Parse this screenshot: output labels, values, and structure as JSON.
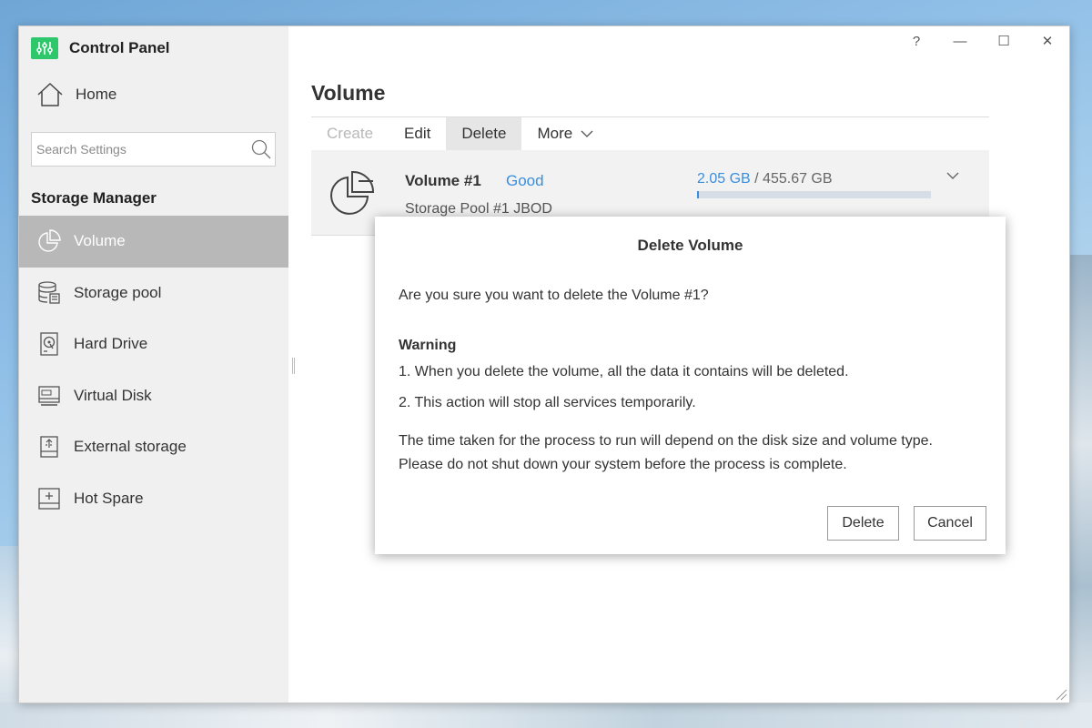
{
  "app": {
    "title": "Control Panel",
    "logo_color": "#2ec76b"
  },
  "sidebar": {
    "home_label": "Home",
    "search_placeholder": "Search Settings",
    "section_title": "Storage Manager",
    "items": [
      {
        "label": "Volume",
        "icon": "pie-chart-icon",
        "active": true
      },
      {
        "label": "Storage pool",
        "icon": "database-icon"
      },
      {
        "label": "Hard Drive",
        "icon": "hard-drive-icon"
      },
      {
        "label": "Virtual Disk",
        "icon": "virtual-disk-icon"
      },
      {
        "label": "External storage",
        "icon": "external-storage-icon"
      },
      {
        "label": "Hot Spare",
        "icon": "hot-spare-icon"
      }
    ]
  },
  "window_controls": {
    "help": "?",
    "minimize": "—",
    "maximize": "☐",
    "close": "✕"
  },
  "main": {
    "title": "Volume",
    "toolbar": {
      "create": "Create",
      "edit": "Edit",
      "delete": "Delete",
      "more": "More"
    },
    "volume": {
      "name": "Volume #1",
      "status": "Good",
      "pool": "Storage Pool #1  JBOD",
      "used": "2.05 GB",
      "separator": " / ",
      "total": "455.67 GB",
      "usage_fraction": 0.0045
    }
  },
  "dialog": {
    "title": "Delete Volume",
    "question": "Are you sure you want to delete the Volume #1?",
    "warning_title": "Warning",
    "warning_1": "1. When you delete the volume, all the data it contains will be deleted.",
    "warning_2": "2. This action will stop all services temporarily.",
    "time_note": "The time taken for the process to run will depend on the disk size and volume type.",
    "shutdown_note": "Please do not shut down your system before the process is complete.",
    "delete_label": "Delete",
    "cancel_label": "Cancel"
  },
  "colors": {
    "accent": "#3a8ee0",
    "active_nav": "#b8b8b8"
  }
}
